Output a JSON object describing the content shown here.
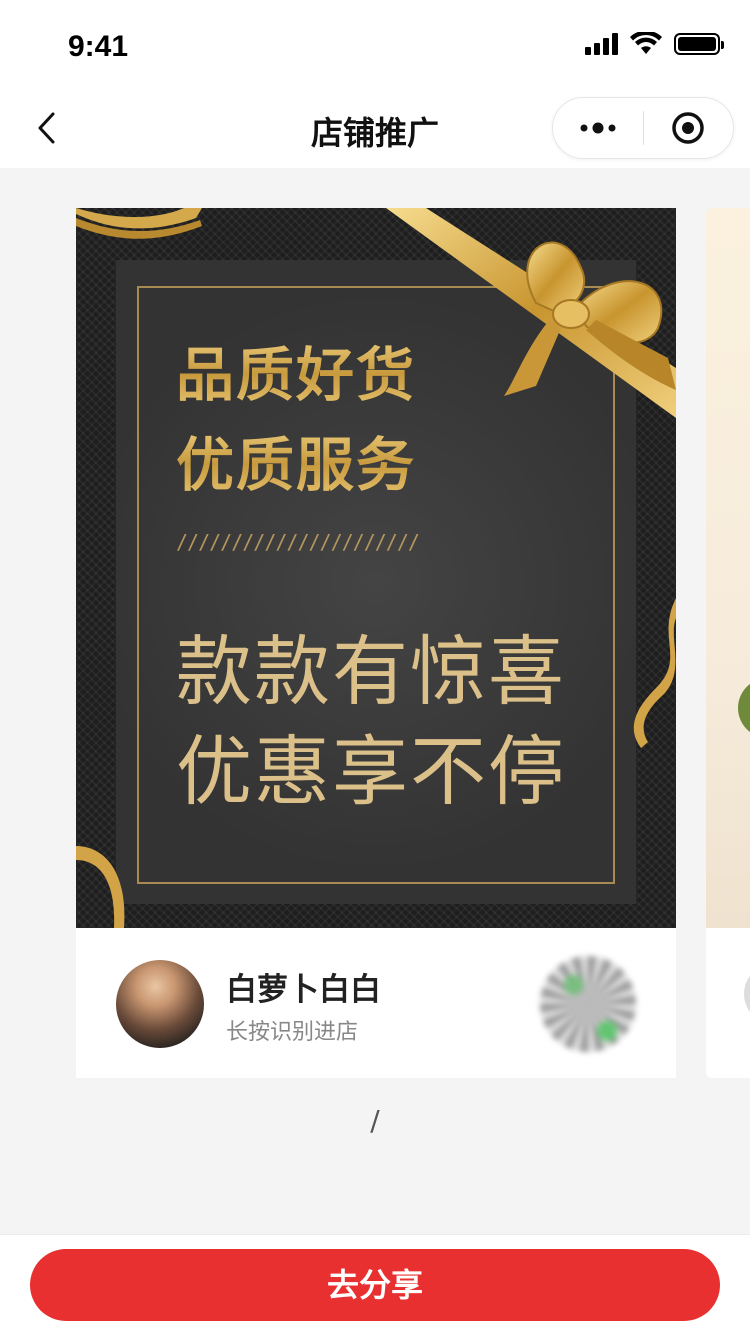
{
  "status_bar": {
    "time": "9:41"
  },
  "nav": {
    "title": "店铺推广",
    "back_icon": "chevron-left-icon",
    "more_icon": "more-dots-icon",
    "close_icon": "target-close-icon"
  },
  "poster": {
    "headline_line1": "品质好货",
    "headline_line2": "优质服务",
    "divider_slashes": "//////////////////////",
    "promo_line1": "款款有惊喜",
    "promo_line2": "优惠享不停",
    "shop_name": "白萝卜白白",
    "shop_hint": "长按识别进店",
    "colors": {
      "gold": "#d6ad55",
      "panel": "#3b3b3b",
      "background": "#1e1e1e"
    }
  },
  "pager": {
    "text": "/"
  },
  "bottom": {
    "share_label": "去分享",
    "accent": "#e93030"
  }
}
